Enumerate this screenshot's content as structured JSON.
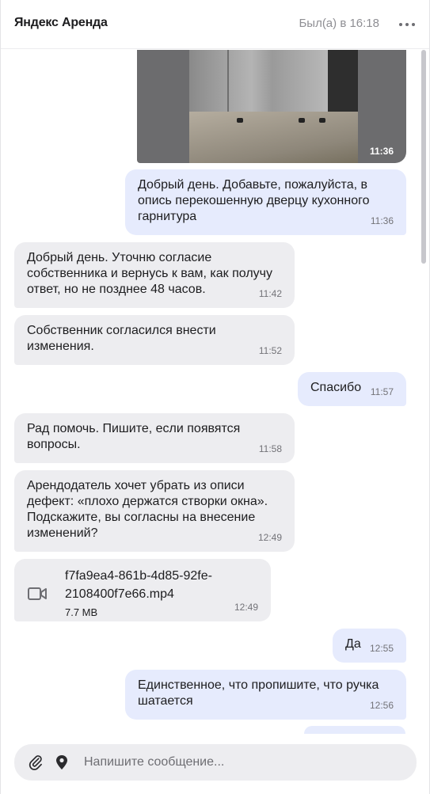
{
  "header": {
    "title": "Яндекс Аренда",
    "status": "Был(а) в 16:18",
    "more_icon": "more-horizontal-icon"
  },
  "messages": [
    {
      "type": "photo",
      "direction": "out",
      "time": "11:36"
    },
    {
      "type": "text",
      "direction": "out",
      "text": "Добрый день. Добавьте, пожалуйста, в опись перекошенную дверцу кухонного гарнитура",
      "time": "11:36"
    },
    {
      "type": "text",
      "direction": "in",
      "text": "Добрый день. Уточню согласие собственника и вернусь к вам, как получу ответ, но не позднее 48 часов.",
      "time": "11:42"
    },
    {
      "type": "text",
      "direction": "in",
      "text": "Собственник согласился внести изменения.",
      "time": "11:52"
    },
    {
      "type": "text",
      "direction": "out",
      "text": "Спасибо",
      "time": "11:57"
    },
    {
      "type": "text",
      "direction": "in",
      "text": "Рад помочь. Пишите, если появятся вопросы.",
      "time": "11:58"
    },
    {
      "type": "text",
      "direction": "in",
      "text": "Арендодатель хочет убрать из описи дефект: «плохо держатся створки окна». Подскажите, вы согласны на внесение изменений?",
      "time": "12:49"
    },
    {
      "type": "file",
      "direction": "in",
      "file_name": "f7fa9ea4-861b-4d85-92fe-2108400f7e66.mp4",
      "file_size": "7.7 MB",
      "time": "12:49",
      "icon": "video-camera-icon"
    },
    {
      "type": "text",
      "direction": "out",
      "text": "Да",
      "time": "12:55"
    },
    {
      "type": "text",
      "direction": "out",
      "text": "Единственное, что пропишите, что ручка шатается",
      "time": "12:56"
    }
  ],
  "composer": {
    "placeholder": "Напишите сообщение...",
    "attach_icon": "paperclip-icon",
    "location_icon": "location-pin-icon"
  },
  "colors": {
    "outgoing_bubble": "#e6ebfd",
    "incoming_bubble": "#ededf0",
    "muted_text": "#8e8e93"
  }
}
